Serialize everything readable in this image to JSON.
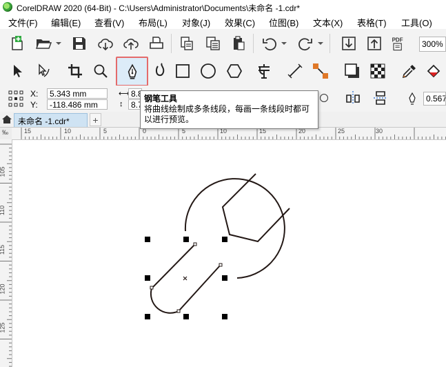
{
  "title_bar": {
    "title": "CorelDRAW 2020 (64-Bit) - C:\\Users\\Administrator\\Documents\\未命名 -1.cdr*"
  },
  "menu": {
    "items": [
      "文件(F)",
      "编辑(E)",
      "查看(V)",
      "布局(L)",
      "对象(J)",
      "效果(C)",
      "位图(B)",
      "文本(X)",
      "表格(T)",
      "工具(O)"
    ]
  },
  "toolbar": {
    "zoom_value": "300%",
    "pdf_label": "PDF"
  },
  "property_bar": {
    "x_label": "X:",
    "x_value": "5.343 mm",
    "y_label": "Y:",
    "y_value": "-118.486 mm",
    "w_value": "8.8",
    "h_value": "8.7",
    "outline_value": "0.567"
  },
  "tooltip": {
    "title": "钢笔工具",
    "body": "将曲线绘制成多条线段，每画一条线段时都可以进行预览。"
  },
  "document_tab": {
    "label": "未命名 -1.cdr*"
  },
  "ruler": {
    "top_labels": [
      "15",
      "10",
      "5",
      "0",
      "5",
      "10",
      "15",
      "20",
      "25",
      "30"
    ],
    "left_labels": [
      "105",
      "110",
      "115",
      "120",
      "125"
    ],
    "corner_label": "‰"
  },
  "colors": {
    "selected_tool_border": "#e46a6a",
    "selected_tool_fill": "#dcecf8",
    "doc_tab_fill": "#cfe3f3",
    "shape_stroke": "#231815"
  }
}
